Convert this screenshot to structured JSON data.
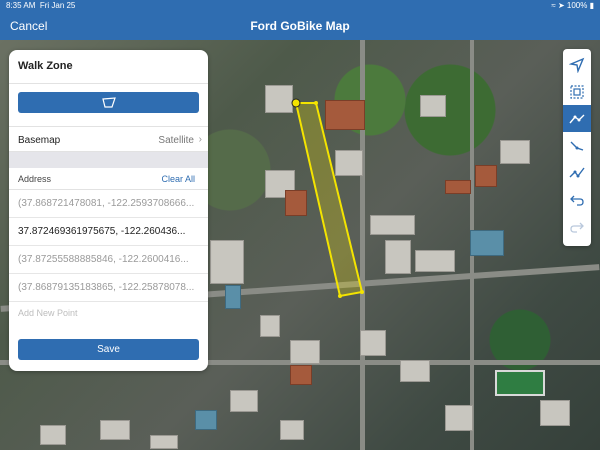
{
  "status": {
    "time": "8:35 AM",
    "date": "Fri Jan 25",
    "battery": "100%"
  },
  "nav": {
    "cancel_label": "Cancel",
    "title": "Ford GoBike Map"
  },
  "panel": {
    "title": "Walk Zone",
    "shape_icon": "polygon-icon",
    "basemap_label": "Basemap",
    "basemap_value": "Satellite",
    "address_label": "Address",
    "clear_all_label": "Clear All",
    "points": [
      "(37.868721478081, -122.2593708666...",
      "37.872469361975675, -122.260436...",
      "(37.87255588885846, -122.2600416...",
      "(37.86879135183865, -122.25878078..."
    ],
    "add_point_placeholder": "Add New Point",
    "save_label": "Save"
  },
  "toolbar": {
    "tools": [
      {
        "name": "navigate-arrow-icon",
        "selected": false
      },
      {
        "name": "select-frame-icon",
        "selected": false
      },
      {
        "name": "polyline-draw-icon",
        "selected": true
      },
      {
        "name": "line-segment-icon",
        "selected": false
      },
      {
        "name": "freehand-line-icon",
        "selected": false
      },
      {
        "name": "undo-icon",
        "selected": false
      },
      {
        "name": "redo-icon",
        "selected": false
      }
    ]
  },
  "colors": {
    "accent": "#2f6db1",
    "polygon": "#f4e400"
  }
}
